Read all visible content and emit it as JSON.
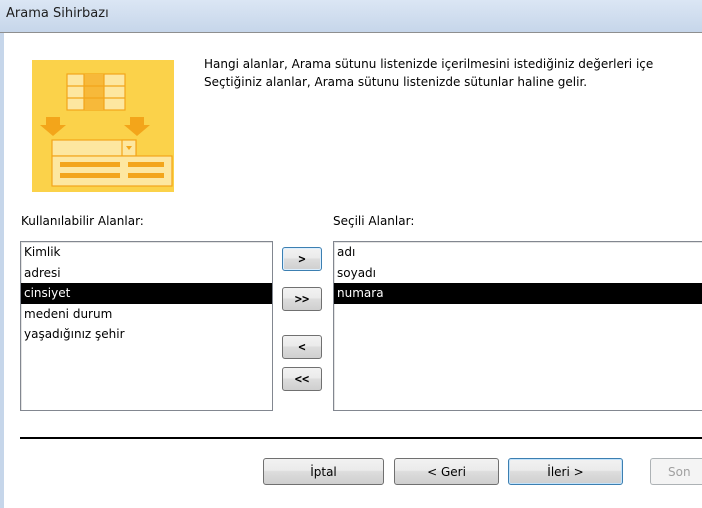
{
  "window": {
    "title": "Arama Sihirbazı"
  },
  "description": {
    "line1": "Hangi alanlar, Arama sütunu listenizde içerilmesini istediğiniz değerleri içe",
    "line2": "Seçtiğiniz alanlar, Arama sütunu listenizde sütunlar haline gelir."
  },
  "available": {
    "label": "Kullanılabilir Alanlar:",
    "items": [
      "Kimlik",
      "adresi",
      "cinsiyet",
      "medeni durum",
      "yaşadığınız şehir"
    ],
    "selected": "cinsiyet"
  },
  "chosen": {
    "label": "Seçili Alanlar:",
    "items": [
      "adı",
      "soyadı",
      "numara"
    ],
    "selected": "numara"
  },
  "move_buttons": {
    "add_one": ">",
    "add_all": ">>",
    "remove_one": "<",
    "remove_all": "<<"
  },
  "footer": {
    "cancel": "İptal",
    "back": "< Geri",
    "next": "İleri >",
    "finish": "Son"
  },
  "colors": {
    "hero_bg": "#fbd24a",
    "selection": "#000000",
    "titlebar": "#c6d6ea"
  }
}
